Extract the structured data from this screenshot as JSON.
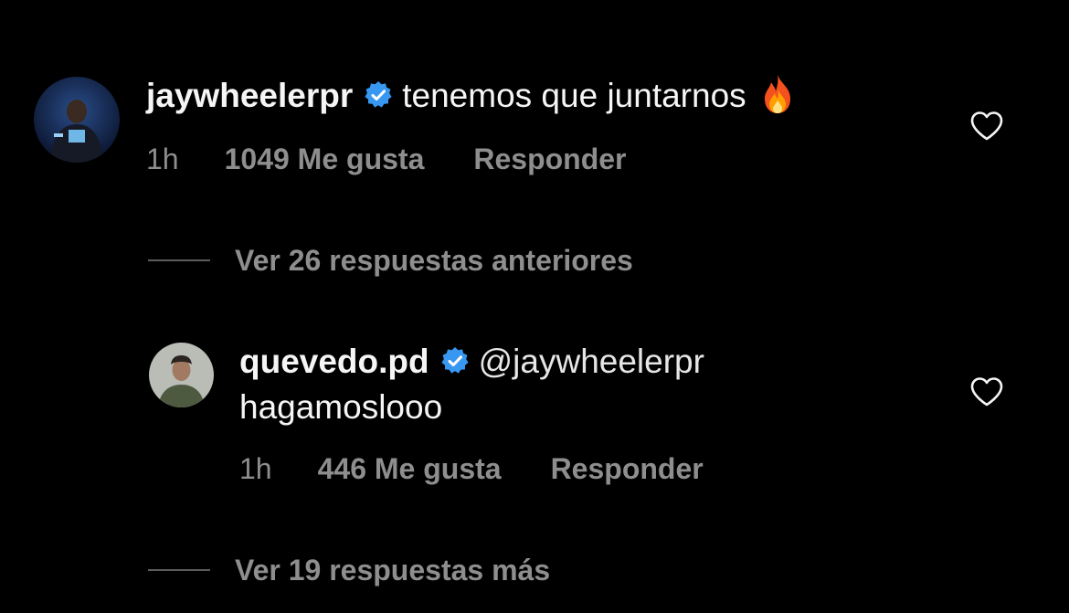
{
  "comments": [
    {
      "username": "jaywheelerpr",
      "verified": true,
      "text": "tenemos que juntarnos",
      "emoji": "fire-emoji",
      "time": "1h",
      "likes": "1049 Me gusta",
      "reply_label": "Responder"
    }
  ],
  "view_previous_replies": "Ver 26 respuestas anteriores",
  "reply": {
    "username": "quevedo.pd",
    "verified": true,
    "mention": "@jaywheelerpr",
    "text": "hagamoslooo",
    "time": "1h",
    "likes": "446 Me gusta",
    "reply_label": "Responder"
  },
  "view_more_replies": "Ver 19 respuestas más",
  "colors": {
    "background": "#000000",
    "primary_text": "#f5f5f5",
    "secondary_text": "#8e8e8e",
    "verified_badge": "#3897f0"
  },
  "icons": {
    "verified": "verified-badge-icon",
    "like": "heart-outline-icon"
  }
}
